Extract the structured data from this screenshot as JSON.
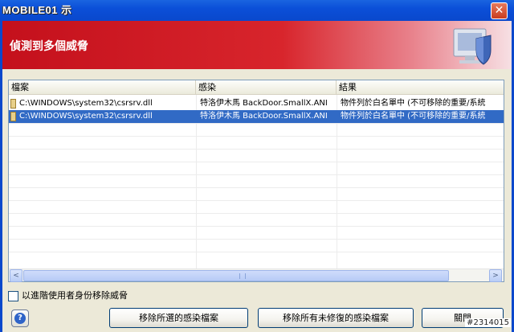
{
  "window": {
    "title": "MOBILE01 示",
    "close_glyph": "✕"
  },
  "banner": {
    "title": "偵測到多個威脅",
    "icon": "shield-computer-icon"
  },
  "list": {
    "columns": [
      "檔案",
      "感染",
      "結果"
    ],
    "rows": [
      {
        "file": "C:\\WINDOWS\\system32\\csrsrv.dll",
        "infection": "特洛伊木馬 BackDoor.SmallX.ANI",
        "result": "物件列於白名單中 (不可移除的重要/系統",
        "selected": false
      },
      {
        "file": "C:\\WINDOWS\\system32\\csrsrv.dll",
        "infection": "特洛伊木馬 BackDoor.SmallX.ANI",
        "result": "物件列於白名單中 (不可移除的重要/系統",
        "selected": true
      }
    ],
    "scroll_left": "<",
    "scroll_right": ">"
  },
  "options": {
    "admin_checkbox_label": "以進階使用者身份移除威脅",
    "admin_checkbox_checked": false
  },
  "buttons": {
    "help_glyph": "?",
    "remove_selected": "移除所選的感染檔案",
    "remove_all_unrepaired": "移除所有未修復的感染檔案",
    "close": "關閉"
  },
  "watermark": "#2314015",
  "colors": {
    "title_bar": "#0a48cc",
    "banner_red": "#d8252c",
    "selection": "#316ac5"
  }
}
